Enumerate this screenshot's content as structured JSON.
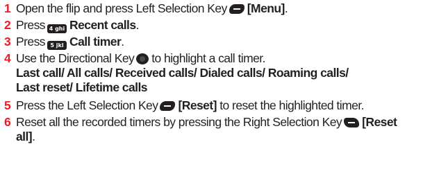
{
  "steps": [
    {
      "num": "1",
      "pre": "Open the flip and press Left Selection Key",
      "key_label": "",
      "post": "[Menu]",
      "tail": "."
    },
    {
      "num": "2",
      "pre": "Press",
      "key_label": "4 ghi",
      "post": "Recent calls",
      "tail": "."
    },
    {
      "num": "3",
      "pre": "Press",
      "key_label": "5 jkl",
      "post": "Call timer",
      "tail": "."
    },
    {
      "num": "4",
      "pre": "Use the Directional Key",
      "post": "to highlight a call timer."
    },
    {
      "num": "5",
      "pre": "Press the Left Selection Key",
      "post": "[Reset]",
      "tail": "to reset the highlighted timer."
    },
    {
      "num": "6",
      "pre": "Reset all the recorded timers by pressing the Right Selection Key",
      "post": "[Reset",
      "cont": "all]",
      "tail": "."
    }
  ],
  "timer_options_line1": "Last call/ All calls/ Received calls/ Dialed calls/ Roaming calls/",
  "timer_options_line2": "Last reset/ Lifetime calls"
}
